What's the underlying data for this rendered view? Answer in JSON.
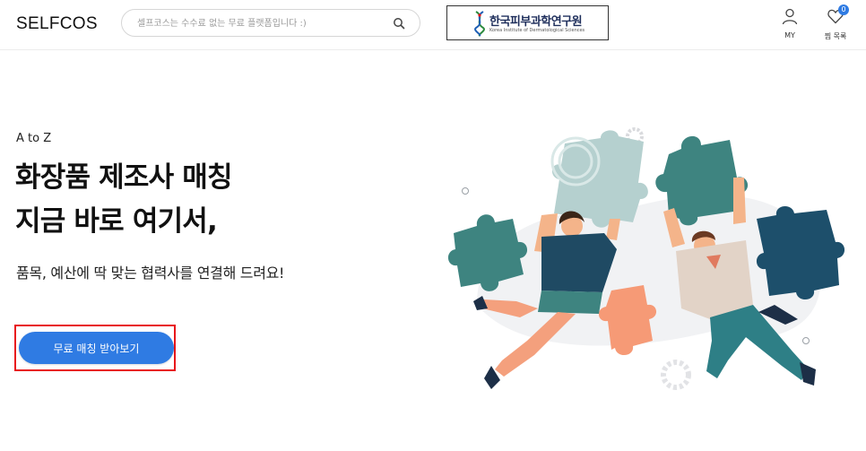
{
  "header": {
    "logo": "SELFCOS",
    "search": {
      "placeholder": "셀프코스는 수수료 없는 무료 플랫폼입니다 :)",
      "value": "",
      "icon": "search-icon"
    },
    "partner": {
      "name": "한국피부과학연구원",
      "subtitle": "Korea Institute of Dermatological Sciences"
    },
    "nav": {
      "my": {
        "label": "MY",
        "icon": "user-icon"
      },
      "wishlist": {
        "label": "찜 목록",
        "icon": "heart-icon",
        "count": "0"
      }
    }
  },
  "hero": {
    "eyebrow": "A to Z",
    "headline_line1": "화장품 제조사 매칭",
    "headline_line2": "지금 바로 여기서,",
    "subtext": "품목, 예산에 딱 맞는 협력사를 연결해 드려요!",
    "cta_label": "무료 매칭 받아보기"
  },
  "colors": {
    "accent": "#2f7be3",
    "highlight_border": "#e8141a",
    "puzzle_teal": "#3e8480",
    "puzzle_sage": "#b5d0cf",
    "puzzle_navy": "#1d4f6b",
    "puzzle_orange": "#f69a76"
  }
}
